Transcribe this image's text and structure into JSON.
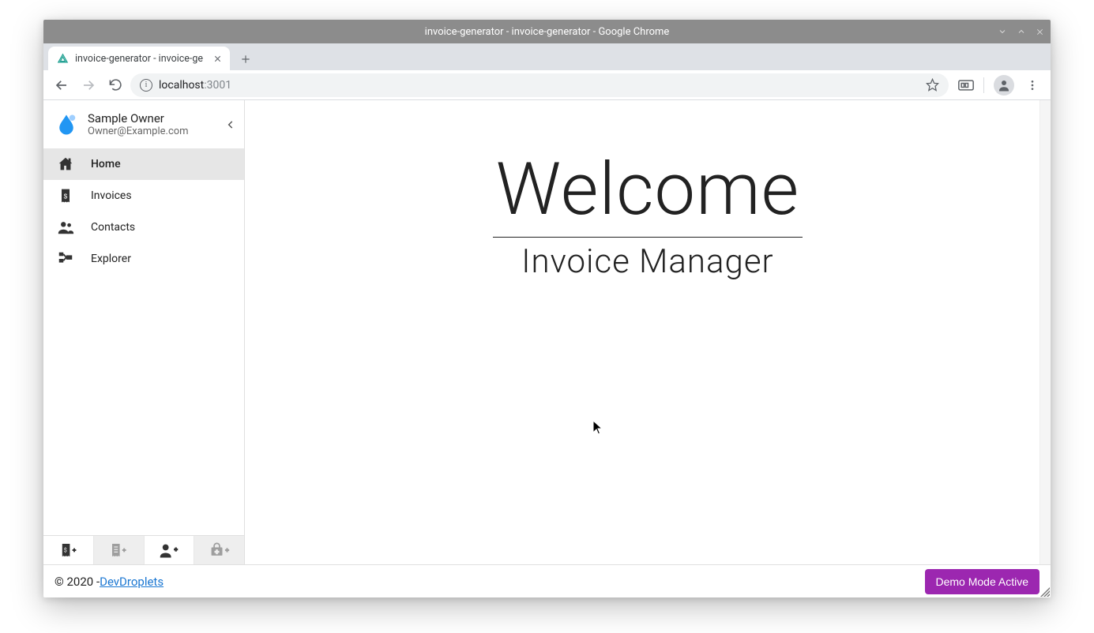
{
  "os": {
    "title": "invoice-generator - invoice-generator - Google Chrome"
  },
  "browser": {
    "tab": {
      "title": "invoice-generator - invoice-ge"
    },
    "url_host": "localhost",
    "url_port": ":3001"
  },
  "profile": {
    "name": "Sample Owner",
    "email": "Owner@Example.com"
  },
  "sidebar": {
    "items": [
      {
        "label": "Home"
      },
      {
        "label": "Invoices"
      },
      {
        "label": "Contacts"
      },
      {
        "label": "Explorer"
      }
    ]
  },
  "hero": {
    "title": "Welcome",
    "subtitle": "Invoice Manager"
  },
  "footer": {
    "prefix": "© 2020 - ",
    "link_label": "DevDroplets",
    "demo_label": "Demo Mode Active"
  }
}
